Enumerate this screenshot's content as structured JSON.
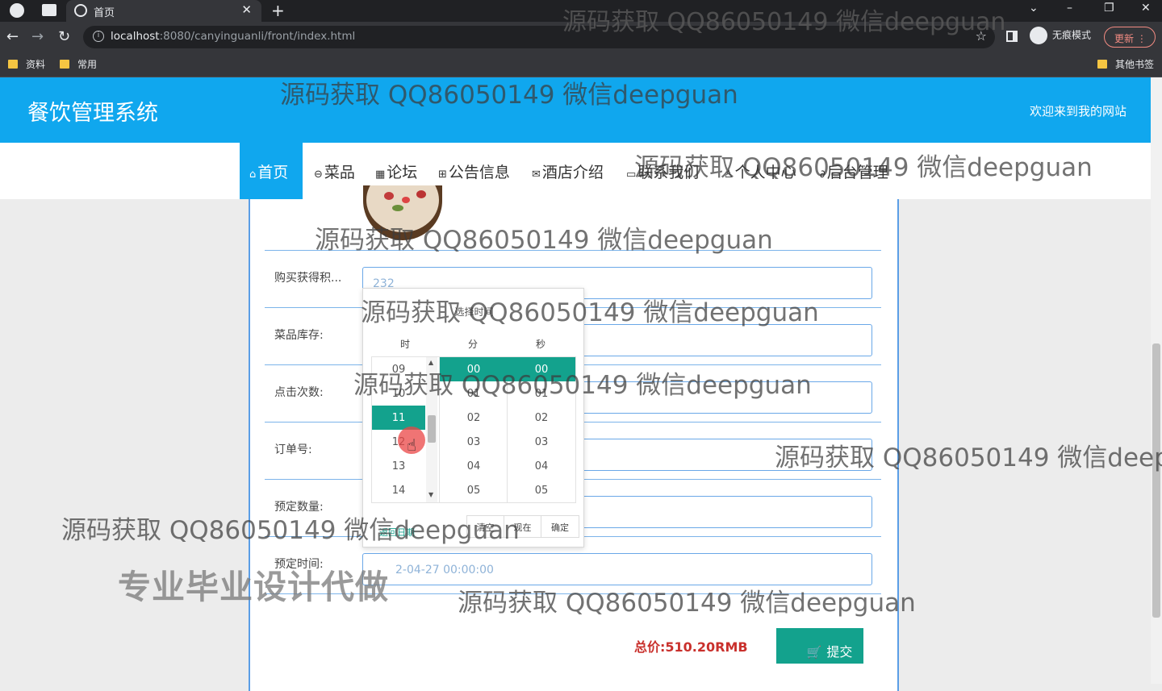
{
  "browser": {
    "tab_title": "首页",
    "url_host": "localhost",
    "url_rest": ":8080/canyinguanli/front/index.html",
    "incognito_label": "无痕模式",
    "update_label": "更新",
    "bookmarks": [
      "资料",
      "常用"
    ],
    "other_bookmarks": "其他书签"
  },
  "site": {
    "title": "餐饮管理系统",
    "welcome": "欢迎来到我的网站",
    "nav": [
      {
        "label": "首页",
        "icon": "home-icon"
      },
      {
        "label": "菜品",
        "icon": "dish-icon"
      },
      {
        "label": "论坛",
        "icon": "forum-icon"
      },
      {
        "label": "公告信息",
        "icon": "notice-icon"
      },
      {
        "label": "酒店介绍",
        "icon": "hotel-icon"
      },
      {
        "label": "联系我们",
        "icon": "contact-icon"
      },
      {
        "label": "个人中心",
        "icon": "user-icon"
      },
      {
        "label": "后台管理",
        "icon": "link-icon"
      }
    ]
  },
  "form": {
    "fields": [
      {
        "label": "购买获得积...",
        "value": "232"
      },
      {
        "label": "菜品库存:",
        "value": ""
      },
      {
        "label": "点击次数:",
        "value": ""
      },
      {
        "label": "订单号:",
        "value": ""
      },
      {
        "label": "预定数量:",
        "value": ""
      },
      {
        "label": "预定时间:",
        "value": "2-04-27 00:00:00"
      }
    ],
    "total_label": "总价:",
    "total_value": "510.20RMB",
    "submit_label": "提交"
  },
  "time_picker": {
    "title": "选择时间",
    "headers": [
      "时",
      "分",
      "秒"
    ],
    "hours": [
      "09",
      "10",
      "11",
      "12",
      "13",
      "14"
    ],
    "selected_hour": "11",
    "minutes": [
      "00",
      "01",
      "02",
      "03",
      "04",
      "05"
    ],
    "seconds": [
      "00",
      "01",
      "02",
      "03",
      "04",
      "05"
    ],
    "back_label": "返回日期",
    "buttons": [
      "清空",
      "现在",
      "确定"
    ]
  },
  "watermarks": {
    "contact": "源码获取 QQ86050149 微信deepguan",
    "contact_cut": "源码获取 QQ86050149 微信deepg",
    "service": "专业毕业设计代做"
  }
}
